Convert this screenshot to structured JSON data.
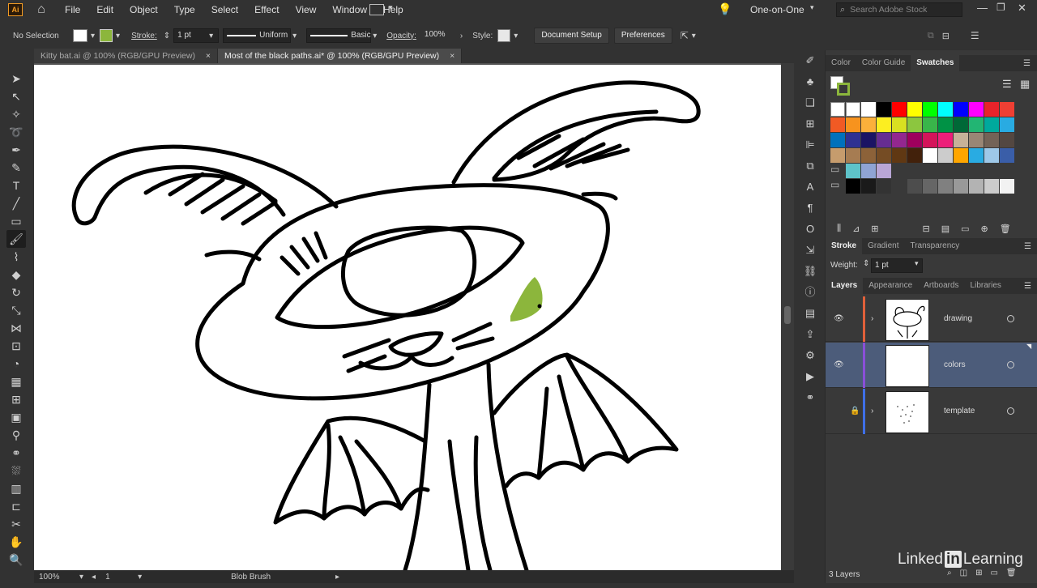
{
  "app": {
    "logo": "Ai"
  },
  "menubar": {
    "items": [
      "File",
      "Edit",
      "Object",
      "Type",
      "Select",
      "Effect",
      "View",
      "Window",
      "Help"
    ],
    "workspace": "One-on-One",
    "search_placeholder": "Search Adobe Stock"
  },
  "control": {
    "selection": "No Selection",
    "stroke_label": "Stroke:",
    "stroke_value": "1 pt",
    "profile": "Uniform",
    "brush": "Basic",
    "opacity_label": "Opacity:",
    "opacity_value": "100%",
    "style_label": "Style:",
    "document_setup": "Document Setup",
    "preferences": "Preferences"
  },
  "tabs": [
    {
      "label": "Kitty bat.ai @ 100% (RGB/GPU Preview)",
      "close": "×",
      "active": false
    },
    {
      "label": "Most of the black paths.ai* @ 100% (RGB/GPU Preview)",
      "close": "×",
      "active": true
    }
  ],
  "status": {
    "zoom": "100%",
    "artboard": "1",
    "tool": "Blob Brush"
  },
  "panels": {
    "color_tabs": [
      "Color",
      "Color Guide",
      "Swatches"
    ],
    "stroke_tabs": [
      "Stroke",
      "Gradient",
      "Transparency"
    ],
    "weight_label": "Weight:",
    "weight_value": "1 pt",
    "layers_tabs": [
      "Layers",
      "Appearance",
      "Artboards",
      "Libraries"
    ],
    "layers": [
      {
        "name": "drawing",
        "color": "#e0603a",
        "visible": true,
        "locked": false
      },
      {
        "name": "colors",
        "color": "#8a4fd8",
        "visible": true,
        "locked": false
      },
      {
        "name": "template",
        "color": "#3f6fe8",
        "visible": false,
        "locked": true
      }
    ],
    "layer_count": "3 Layers"
  },
  "swatch_colors": {
    "row1": [
      "#ffffff",
      "#000000",
      "#ff0000",
      "#ffff00",
      "#00ff00",
      "#00ffff",
      "#0000ff",
      "#ff00ff",
      "#ed1c24"
    ],
    "accent_green": "#8cb63c",
    "selection_blue": "#4c5c7a"
  },
  "watermark": {
    "prefix": "Linked",
    "badge": "in",
    "suffix": "Learning"
  }
}
